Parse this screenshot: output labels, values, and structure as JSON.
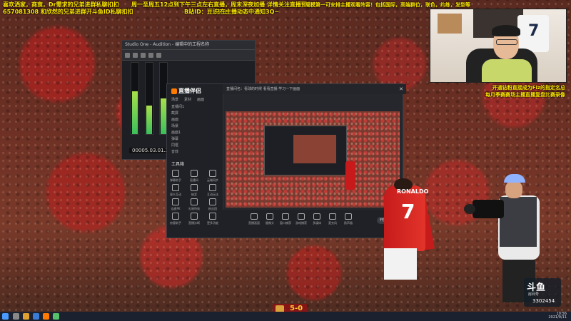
{
  "overlay_top_left": {
    "line1": "喜欢洒家，商衰，Dr需求的兄弟进群私聊扣扣",
    "line2": "657081308 和欣然的兄弟进群开斗鱼ID私聊扣扣",
    "line3": "B站ID：豆豉Fiz",
    "line4": "只在主播动态中通知3Q~"
  },
  "overlay_top_mid": "周一至周五12点到下午三点左右直播，周末深夜加播 详情关注直播预告",
  "overlay_top_right": "周模第一可安排主播观看阵容！包括国际，高端群位，联色，约练，发型等",
  "overlay_right": {
    "line1": "开通钻粉直接成为Fiz的指定名总",
    "line2": "每月季赛赛场主播直播复盘比赛录像"
  },
  "small_window": {
    "title": "Studio One - Audition - 编辑中的工程名称",
    "timecode": "00005.03.01.23"
  },
  "douyu_window": {
    "logo_text": "直播伴侣",
    "tabs": [
      "场景",
      "素材",
      "画面"
    ],
    "scenes": [
      "直播间1",
      "截屏",
      "画面",
      "场景",
      "画面1",
      "弹幕",
      "同框",
      "音效"
    ],
    "tools_title": "工具箱",
    "tools": [
      "弹幕助手",
      "直播间",
      "云端同步",
      "观众互动",
      "抽奖",
      "互动玩法",
      "连麦PK",
      "礼物特效",
      "粉丝团",
      "房管助手",
      "直播诊断",
      "更多功能"
    ],
    "top_text": "直播间名：看球的时候 看看直播 学习一下画面",
    "bottom_icons": [
      "直播画面",
      "摄像头",
      "窗口捕获",
      "游戏捕获",
      "多媒体",
      "麦克风",
      "扬声器"
    ],
    "go_live": "开始直播"
  },
  "player": {
    "name": "RONALDO",
    "number": "7"
  },
  "camera_jersey": "7",
  "score": "5-0",
  "douyu_badge": {
    "logo": "斗鱼",
    "sub": "房间号",
    "id": "3302454"
  },
  "taskbar": {
    "time": "10:56",
    "date": "2021/9/11"
  },
  "colors": {
    "overlay_text": "#ffe600",
    "accent": "#ff7a00"
  }
}
